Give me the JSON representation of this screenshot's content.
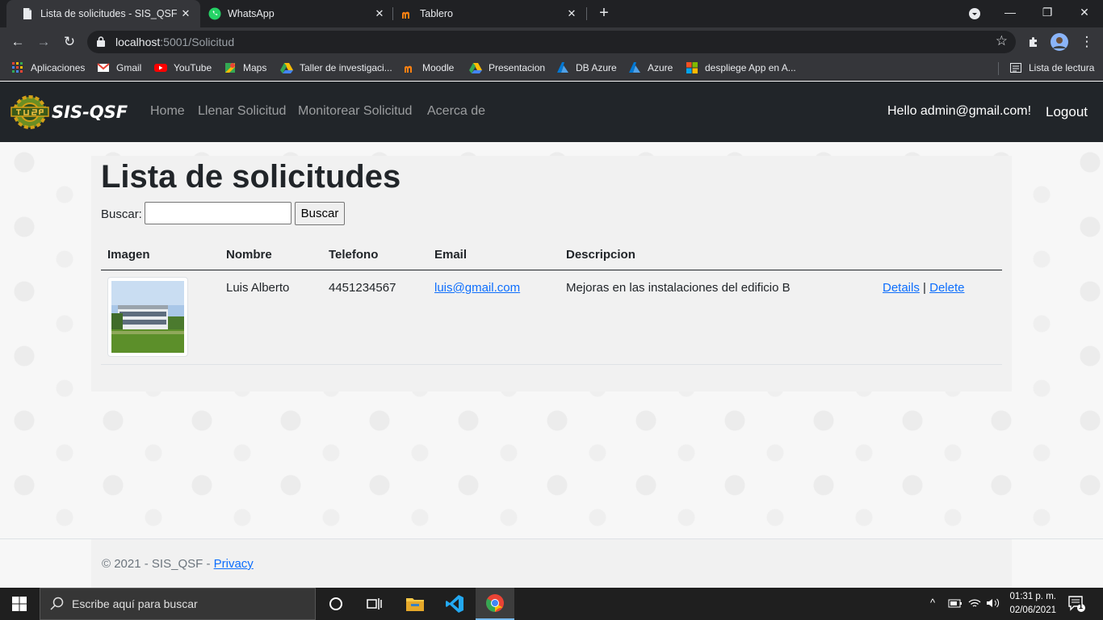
{
  "browser": {
    "tabs": [
      {
        "title": "Lista de solicitudes - SIS_QSF",
        "active": true
      },
      {
        "title": "WhatsApp",
        "active": false
      },
      {
        "title": "Tablero",
        "active": false
      }
    ],
    "new_tab": "+",
    "url_host": "localhost",
    "url_rest": ":5001/Solicitud",
    "bookmarks": [
      "Aplicaciones",
      "Gmail",
      "YouTube",
      "Maps",
      "Taller de investigaci...",
      "Moodle",
      "Presentacion",
      "DB Azure",
      "Azure",
      "despliege App en A..."
    ],
    "reading_list": "Lista de lectura"
  },
  "site": {
    "brand": "SIS-QSF",
    "nav": [
      "Home",
      "Llenar Solicitud",
      "Monitorear Solicitud",
      "Acerca de"
    ],
    "greeting": "Hello admin@gmail.com!",
    "logout": "Logout"
  },
  "main": {
    "title": "Lista de solicitudes",
    "search_label": "Buscar:",
    "search_value": "",
    "search_button": "Buscar",
    "columns": [
      "Imagen",
      "Nombre",
      "Telefono",
      "Email",
      "Descripcion"
    ],
    "rows": [
      {
        "nombre": "Luis Alberto",
        "telefono": "4451234567",
        "email": "luis@gmail.com",
        "descripcion": "Mejoras en las instalaciones del edificio B",
        "details": "Details",
        "separator": "|",
        "delete": "Delete"
      }
    ]
  },
  "footer": {
    "copyright": "© 2021 - SIS_QSF - ",
    "privacy": "Privacy"
  },
  "taskbar": {
    "search_placeholder": "Escribe aquí para buscar",
    "time": "01:31 p. m.",
    "date": "02/06/2021",
    "notifications": "1"
  }
}
